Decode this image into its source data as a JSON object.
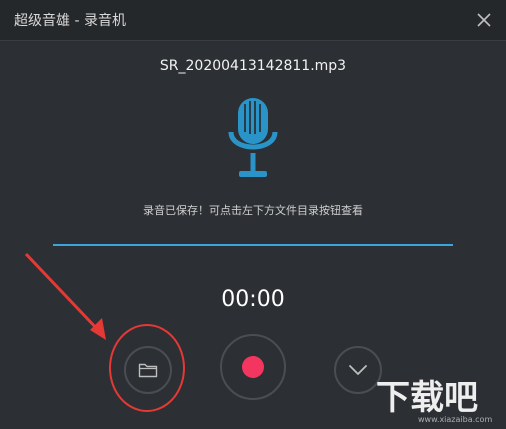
{
  "window": {
    "title": "超级音雄 - 录音机"
  },
  "recording": {
    "filename": "SR_20200413142811.mp3",
    "status_message": "录音已保存！可点击左下方文件目录按钮查看",
    "timer": "00:00",
    "progress_fraction": 1.0
  },
  "controls": {
    "folder": "folder-icon",
    "record": "record-icon",
    "more": "chevron-down-icon"
  },
  "colors": {
    "background": "#2c2f33",
    "accent_blue": "#2a93c8",
    "record_red": "#f2365f",
    "annotation_red": "#e53935"
  },
  "watermark": {
    "text": "下载吧",
    "url": "www.xiazaiba.com"
  }
}
